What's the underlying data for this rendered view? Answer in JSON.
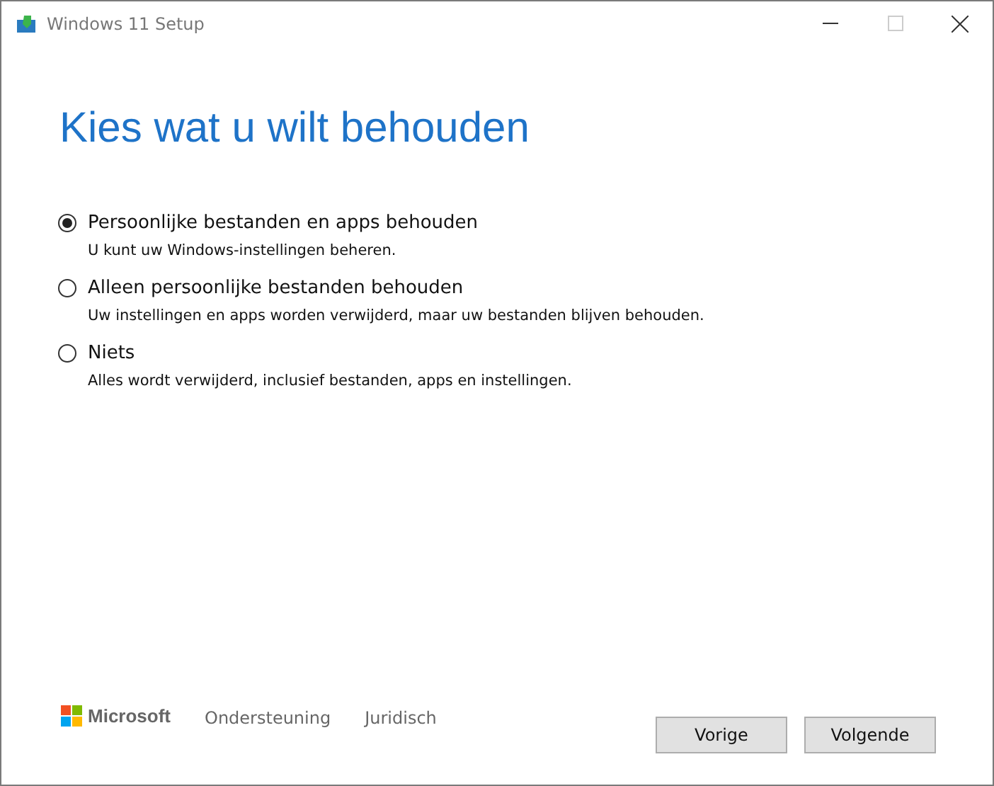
{
  "window": {
    "title": "Windows 11 Setup"
  },
  "heading": "Kies wat u wilt behouden",
  "options": [
    {
      "label": "Persoonlijke bestanden en apps behouden",
      "description": "U kunt uw Windows-instellingen beheren.",
      "selected": true
    },
    {
      "label": "Alleen persoonlijke bestanden behouden",
      "description": "Uw instellingen en apps worden verwijderd, maar uw bestanden blijven behouden.",
      "selected": false
    },
    {
      "label": "Niets",
      "description": "Alles wordt verwijderd, inclusief bestanden, apps en instellingen.",
      "selected": false
    }
  ],
  "footer": {
    "brand": "Microsoft",
    "links": [
      "Ondersteuning",
      "Juridisch"
    ],
    "buttons": [
      "Vorige",
      "Volgende"
    ]
  }
}
